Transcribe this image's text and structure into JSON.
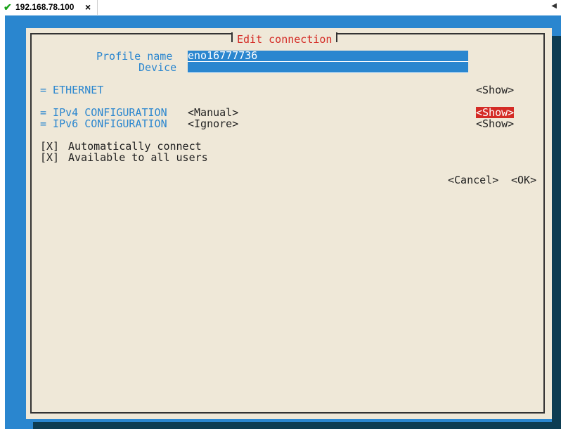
{
  "tab": {
    "title": "192.168.78.100",
    "close": "×",
    "check": "✔"
  },
  "scroll_arrow": "◀",
  "dialog": {
    "title": "Edit connection",
    "profile_name_label": "Profile name",
    "profile_name_value": "eno16777736",
    "device_label": "Device",
    "device_value": "",
    "ethernet_label": "= ETHERNET",
    "ethernet_show": "<Show>",
    "ipv4_label": "= IPv4 CONFIGURATION",
    "ipv4_mode": "<Manual>",
    "ipv4_show": "<Show>",
    "ipv6_label": "= IPv6 CONFIGURATION",
    "ipv6_mode": "<Ignore>",
    "ipv6_show": "<Show>",
    "auto_connect_check": "[X]",
    "auto_connect_label": "Automatically connect",
    "all_users_check": "[X]",
    "all_users_label": "Available to all users",
    "cancel_button": "<Cancel>",
    "ok_button": "<OK>"
  },
  "colors": {
    "terminal_blue": "#2a86cf",
    "dialog_bg": "#efe8d8",
    "accent_red": "#d42b25"
  }
}
